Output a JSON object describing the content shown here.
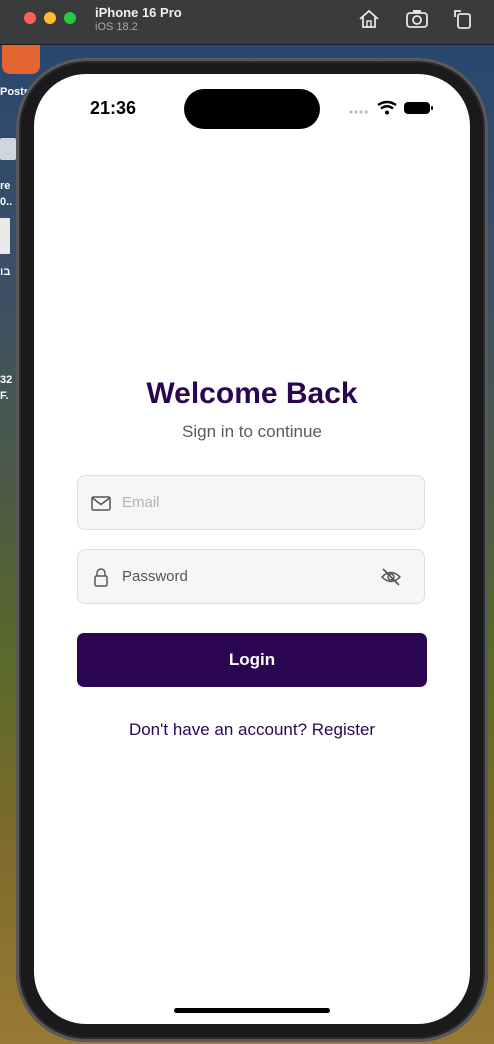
{
  "simulator": {
    "device_name": "iPhone 16 Pro",
    "os_version": "iOS 18.2",
    "home_icon": "home-icon",
    "screenshot_icon": "camera-icon",
    "rotate_icon": "rotate-icon"
  },
  "desktop": {
    "labels": [
      "Postm",
      "re",
      "0..",
      "בו",
      "32",
      "F."
    ]
  },
  "status_bar": {
    "time": "21:36",
    "signal_icon": "cellular-dots-icon",
    "wifi_icon": "wifi-icon",
    "battery_icon": "battery-icon"
  },
  "login": {
    "title": "Welcome Back",
    "subtitle": "Sign in to continue",
    "email_placeholder": "Email",
    "password_placeholder": "Password",
    "login_label": "Login",
    "register_text": "Don't have an account? Register"
  },
  "colors": {
    "brand": "#2a0650",
    "field_bg": "#f6f6f6"
  }
}
